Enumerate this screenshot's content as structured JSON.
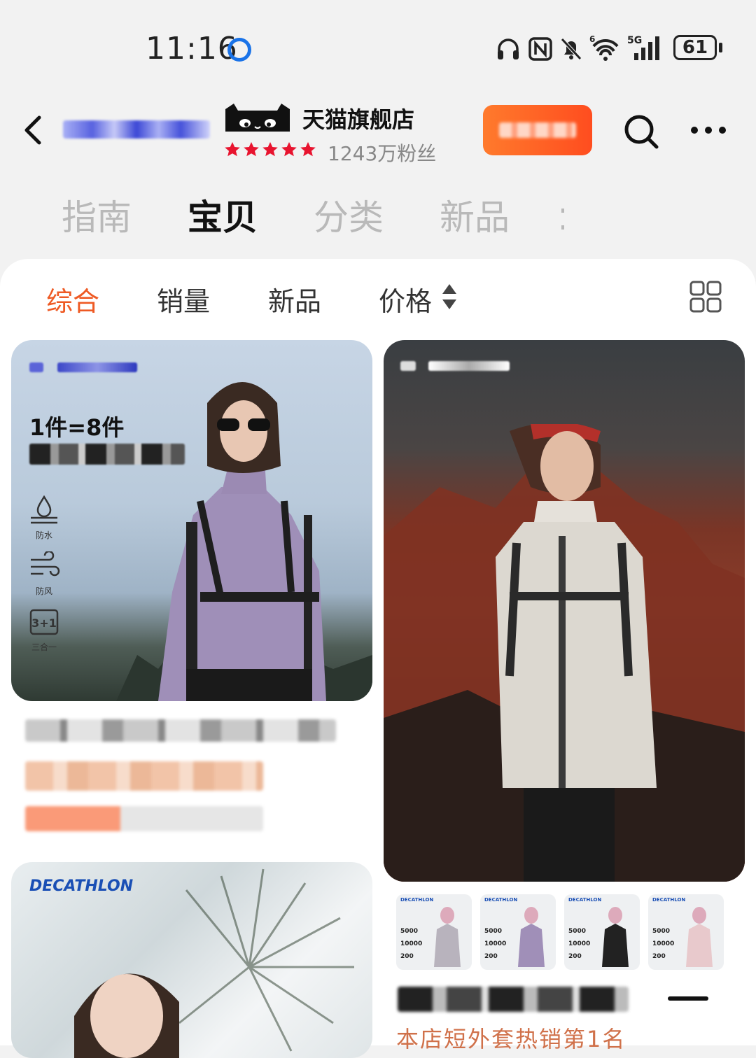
{
  "status_bar": {
    "time": "11:16",
    "battery": "61"
  },
  "header": {
    "store_type": "天猫旗舰店",
    "rating_stars": 5,
    "fans": "1243万粉丝"
  },
  "tabs": [
    {
      "label": "指南",
      "active": false
    },
    {
      "label": "宝贝",
      "active": true
    },
    {
      "label": "分类",
      "active": false
    },
    {
      "label": "新品",
      "active": false
    }
  ],
  "sort": {
    "items": [
      "综合",
      "销量",
      "新品",
      "价格"
    ],
    "active_index": 0
  },
  "products": [
    {
      "promo": "1件=8件",
      "features": [
        "防水",
        "防风",
        "三合一"
      ],
      "feature_badge": "3+1"
    },
    {
      "thumbnails": [
        {
          "brand": "DECATHLON",
          "values": [
            "5000",
            "10000",
            "200"
          ]
        },
        {
          "brand": "DECATHLON",
          "values": [
            "5000",
            "10000",
            "200"
          ]
        },
        {
          "brand": "DECATHLON",
          "values": [
            "5000",
            "10000",
            "200"
          ]
        },
        {
          "brand": "DECATHLON",
          "values": [
            "5000",
            "10000",
            "200"
          ]
        }
      ],
      "title_fragment": "本店短外套热销第1名"
    },
    {
      "brand": "DECATHLON"
    }
  ],
  "colors": {
    "accent": "#ee5a24",
    "follow_gradient": [
      "#ff7a2c",
      "#ff4d1f"
    ],
    "star": "#e8142f"
  }
}
